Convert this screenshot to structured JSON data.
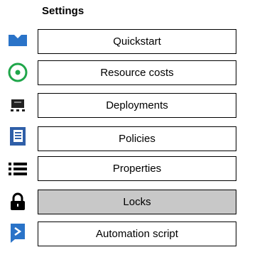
{
  "header": {
    "title": "Settings"
  },
  "items": [
    {
      "label": "Quickstart",
      "icon": "quickstart-icon",
      "selected": false
    },
    {
      "label": "Resource costs",
      "icon": "resource-costs-icon",
      "selected": false
    },
    {
      "label": "Deployments",
      "icon": "deployments-icon",
      "selected": false
    },
    {
      "label": "Policies",
      "icon": "policies-icon",
      "selected": false
    },
    {
      "label": "Properties",
      "icon": "properties-icon",
      "selected": false
    },
    {
      "label": "Locks",
      "icon": "lock-icon",
      "selected": true
    },
    {
      "label": "Automation script",
      "icon": "automation-script-icon",
      "selected": false
    }
  ],
  "colors": {
    "selected_bg": "#c8c8c8",
    "quickstart_blue": "#2a73c8",
    "resource_green": "#1fa64a",
    "policies_blue": "#2f5fa8"
  }
}
